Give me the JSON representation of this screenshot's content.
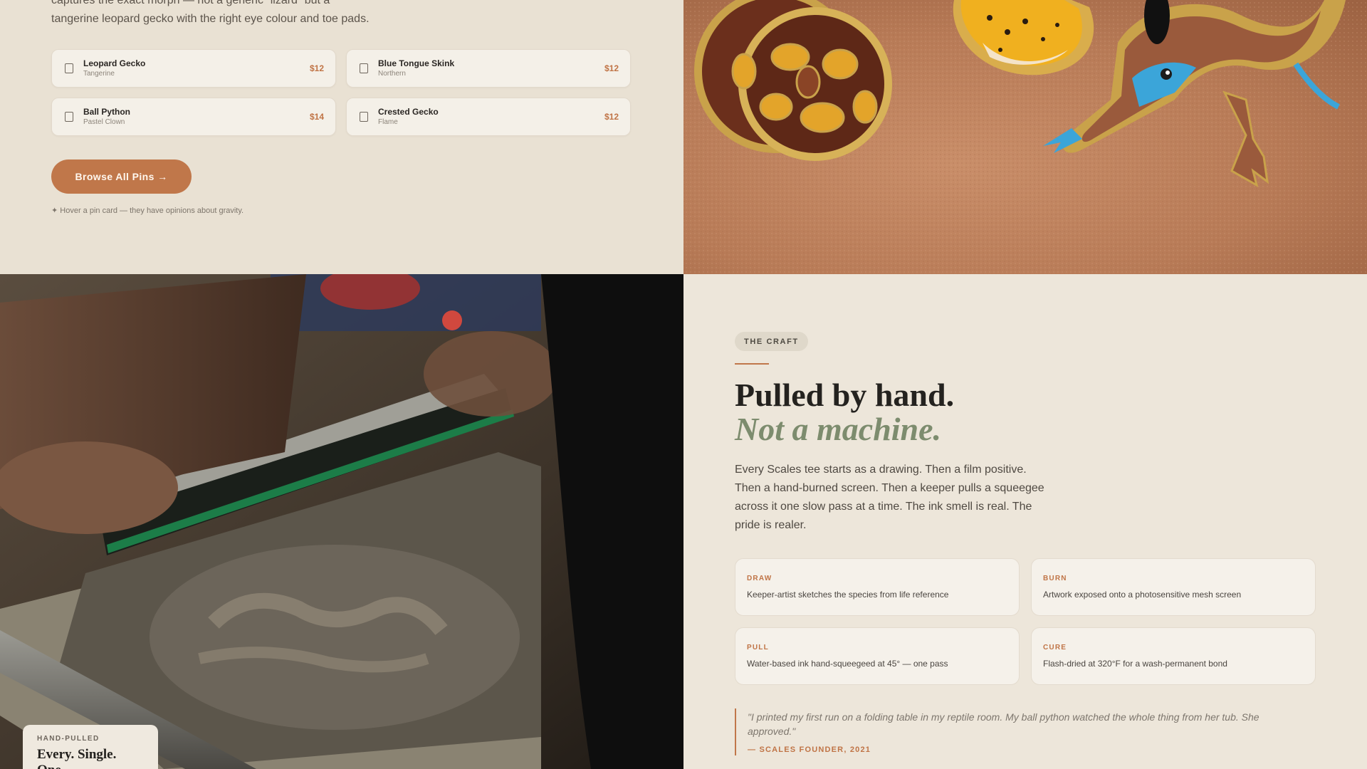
{
  "intro": {
    "line1": "captures the exact morph — not a generic “lizard” but a",
    "line2": "tangerine leopard gecko with the right eye colour and toe pads."
  },
  "pins": [
    {
      "name": "Leopard Gecko",
      "variant": "Tangerine",
      "price": "$12"
    },
    {
      "name": "Blue Tongue Skink",
      "variant": "Northern",
      "price": "$12"
    },
    {
      "name": "Ball Python",
      "variant": "Pastel Clown",
      "price": "$14"
    },
    {
      "name": "Crested Gecko",
      "variant": "Flame",
      "price": "$12"
    }
  ],
  "browse_button": "Browse All Pins →",
  "hint": "✦ Hover a pin card — they have opinions about gravity.",
  "caption": {
    "eyebrow": "HAND-PULLED",
    "title": "Every. Single. One."
  },
  "craft": {
    "tag": "THE CRAFT",
    "headline": "Pulled by hand.",
    "headline_accent": "Not a machine.",
    "body": "Every Scales tee starts as a drawing. Then a film positive. Then a hand-burned screen. Then a keeper pulls a squeegee across it one slow pass at a time. The ink smell is real. The pride is realer.",
    "steps": [
      {
        "label": "DRAW",
        "desc": "Keeper-artist sketches the species from life reference"
      },
      {
        "label": "BURN",
        "desc": "Artwork exposed onto a photosensitive mesh screen"
      },
      {
        "label": "PULL",
        "desc": "Water-based ink hand-squeegeed at 45° — one pass"
      },
      {
        "label": "CURE",
        "desc": "Flash-dried at 320°F for a wash-permanent bond"
      }
    ],
    "quote": "\"I printed my first run on a folding table in my reptile room. My ball python watched the whole thing from her tub. She approved.\"",
    "quote_cite": "— SCALES FOUNDER, 2021"
  },
  "colors": {
    "accent": "#c0774a",
    "sage": "#7d8c6e",
    "background": "#e9e1d3"
  },
  "icons": {
    "pin_checkbox": "checkbox-icon",
    "photo_pins": "enamel-pins-photo",
    "photo_printing": "screen-printing-photo"
  }
}
